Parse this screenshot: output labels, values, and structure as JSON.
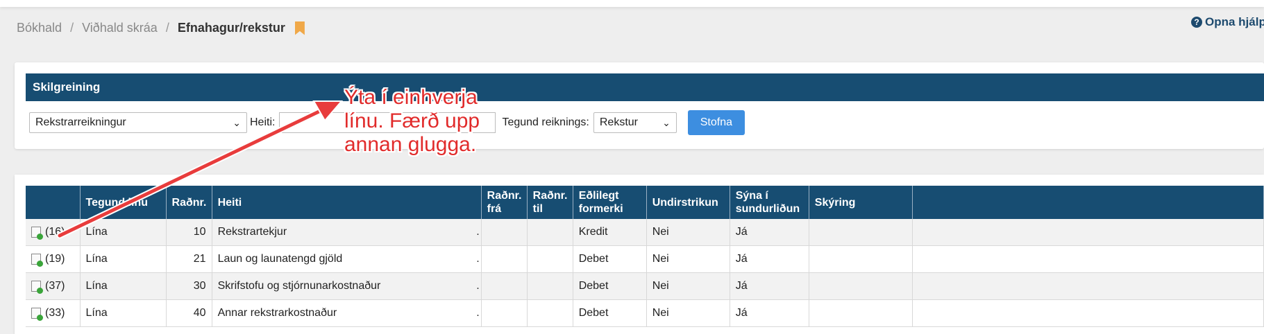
{
  "breadcrumb": {
    "item1": "Bókhald",
    "separator": "/",
    "item2": "Viðhald skráa",
    "current": "Efnahagur/rekstur"
  },
  "help": {
    "icon": "question-circle-icon",
    "label": "Opna hjálp"
  },
  "definition": {
    "header": "Skilgreining",
    "report_select": "Rekstrarreikningur",
    "name_label": "Heiti:",
    "name_value": "",
    "account_type_label": "Tegund reiknings:",
    "account_type_select": "Rekstur",
    "create_button": "Stofna"
  },
  "table": {
    "headers": [
      "",
      "Tegund línu",
      "Raðnr.",
      "Heiti",
      "Raðnr. frá",
      "Raðnr. til",
      "Eðlilegt formerki",
      "Undirstrikun",
      "Sýna í sundurliðun",
      "Skýring",
      ""
    ],
    "rows": [
      {
        "count": "(16)",
        "type": "Lína",
        "order": "10",
        "name": "Rekstrartekjur",
        "dot": ".",
        "from": "",
        "to": "",
        "sign": "Kredit",
        "underline": "Nei",
        "show": "Já",
        "note": ""
      },
      {
        "count": "(19)",
        "type": "Lína",
        "order": "21",
        "name": "Laun og launatengd gjöld",
        "dot": ".",
        "from": "",
        "to": "",
        "sign": "Debet",
        "underline": "Nei",
        "show": "Já",
        "note": ""
      },
      {
        "count": "(37)",
        "type": "Lína",
        "order": "30",
        "name": "Skrifstofu og stjórnunarkostnaður",
        "dot": ".",
        "from": "",
        "to": "",
        "sign": "Debet",
        "underline": "Nei",
        "show": "Já",
        "note": ""
      },
      {
        "count": "(33)",
        "type": "Lína",
        "order": "40",
        "name": "Annar rekstrarkostnaður",
        "dot": ".",
        "from": "",
        "to": "",
        "sign": "Debet",
        "underline": "Nei",
        "show": "Já",
        "note": ""
      }
    ]
  },
  "annotation": {
    "line1": "Ýta í einhverja",
    "line2": "línu. Færð upp",
    "line3": "annan glugga.",
    "color": "#e12b2b"
  },
  "colors": {
    "header_bg": "#174d72",
    "button_bg": "#3d8ee0",
    "bookmark": "#f0a848"
  }
}
